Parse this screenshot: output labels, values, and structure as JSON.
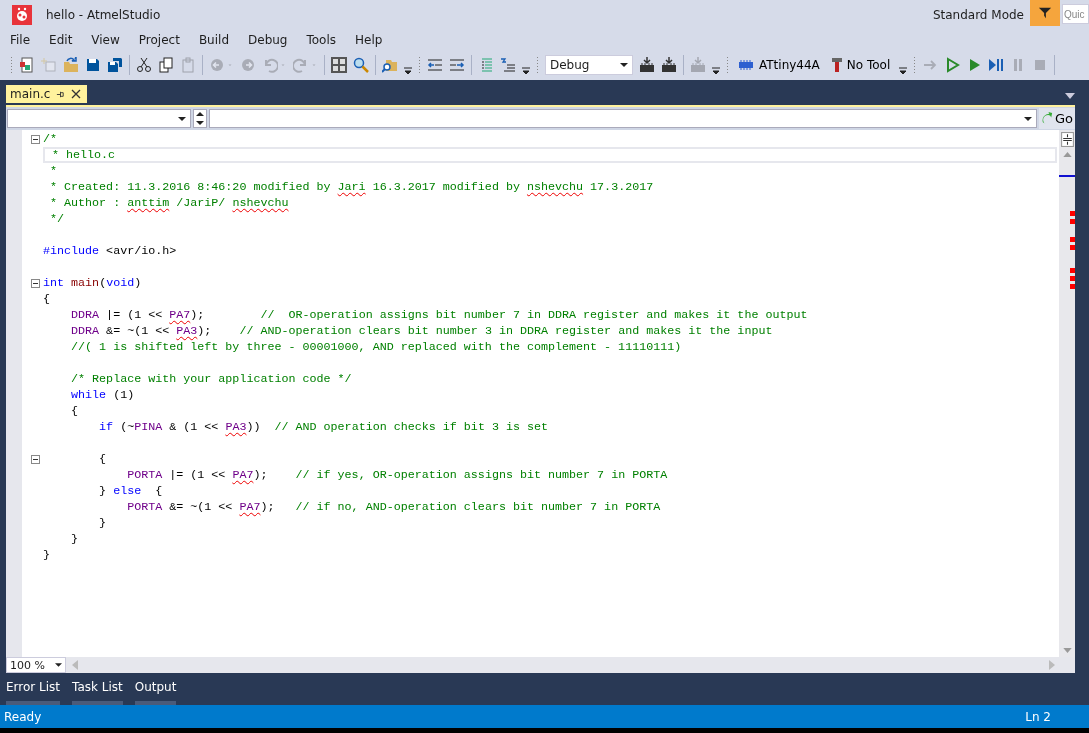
{
  "window": {
    "title": "hello - AtmelStudio"
  },
  "mode": {
    "label": "Standard Mode"
  },
  "quick_launch": {
    "placeholder": "Quic"
  },
  "menu": [
    "File",
    "Edit",
    "View",
    "Project",
    "Build",
    "Debug",
    "Tools",
    "Help"
  ],
  "toolbar": [
    {
      "kind": "grip"
    },
    {
      "kind": "new-project",
      "disabled": false
    },
    {
      "kind": "add-item",
      "disabled": true
    },
    {
      "kind": "open",
      "disabled": false
    },
    {
      "kind": "save",
      "disabled": false
    },
    {
      "kind": "save-all",
      "disabled": false
    },
    {
      "kind": "sep"
    },
    {
      "kind": "cut",
      "disabled": false
    },
    {
      "kind": "copy",
      "disabled": false
    },
    {
      "kind": "paste",
      "disabled": true
    },
    {
      "kind": "sep"
    },
    {
      "kind": "back",
      "disabled": true
    },
    {
      "kind": "caret",
      "disabled": true
    },
    {
      "kind": "forward",
      "disabled": true
    },
    {
      "kind": "undo",
      "disabled": true
    },
    {
      "kind": "caret",
      "disabled": true
    },
    {
      "kind": "redo",
      "disabled": true
    },
    {
      "kind": "caret",
      "disabled": true
    },
    {
      "kind": "sep"
    },
    {
      "kind": "grid",
      "disabled": false
    },
    {
      "kind": "find",
      "disabled": false
    },
    {
      "kind": "sep"
    },
    {
      "kind": "find-files",
      "disabled": false
    },
    {
      "kind": "overflow"
    },
    {
      "kind": "grip"
    },
    {
      "kind": "outdent",
      "disabled": false
    },
    {
      "kind": "indent",
      "disabled": false
    },
    {
      "kind": "sep"
    },
    {
      "kind": "comment",
      "disabled": false
    },
    {
      "kind": "uncomment",
      "disabled": false
    },
    {
      "kind": "overflow"
    },
    {
      "kind": "grip"
    },
    {
      "kind": "combo",
      "value": "Debug"
    },
    {
      "kind": "program",
      "disabled": false
    },
    {
      "kind": "program",
      "disabled": false
    },
    {
      "kind": "sep"
    },
    {
      "kind": "program",
      "disabled": true
    },
    {
      "kind": "overflow"
    },
    {
      "kind": "grip"
    },
    {
      "kind": "device",
      "label": "ATtiny44A"
    },
    {
      "kind": "tool",
      "label": "No Tool"
    },
    {
      "kind": "overflow"
    },
    {
      "kind": "grip"
    },
    {
      "kind": "arrow",
      "disabled": true
    },
    {
      "kind": "play-outline",
      "disabled": false
    },
    {
      "kind": "play",
      "disabled": false
    },
    {
      "kind": "step",
      "disabled": false
    },
    {
      "kind": "pause",
      "disabled": true
    },
    {
      "kind": "stop",
      "disabled": true
    },
    {
      "kind": "sep"
    }
  ],
  "tabs": [
    {
      "label": "main.c",
      "selected": true
    }
  ],
  "go_button": {
    "label": "Go"
  },
  "code": [
    {
      "fold": true,
      "current": false,
      "tokens": [
        {
          "t": "/*",
          "kind": "comment"
        }
      ]
    },
    {
      "fold": false,
      "current": true,
      "tokens": [
        {
          "t": " * hello.c",
          "kind": "comment"
        }
      ]
    },
    {
      "fold": false,
      "current": false,
      "tokens": [
        {
          "t": " *",
          "kind": "comment"
        }
      ]
    },
    {
      "fold": false,
      "current": false,
      "tokens": [
        {
          "t": " * Created: 11.3.2016 8:46:20 modified by ",
          "kind": "comment"
        },
        {
          "t": "Jari",
          "kind": "comment-typo"
        },
        {
          "t": " 16.3.2017 modified by ",
          "kind": "comment"
        },
        {
          "t": "nshevchu",
          "kind": "comment-typo"
        },
        {
          "t": " 17.3.2017",
          "kind": "comment"
        }
      ]
    },
    {
      "fold": false,
      "current": false,
      "tokens": [
        {
          "t": " * Author : ",
          "kind": "comment"
        },
        {
          "t": "anttim",
          "kind": "comment-typo"
        },
        {
          "t": " /JariP/ ",
          "kind": "comment"
        },
        {
          "t": "nshevchu",
          "kind": "comment-typo"
        }
      ]
    },
    {
      "fold": false,
      "current": false,
      "tokens": [
        {
          "t": " */",
          "kind": "comment"
        }
      ]
    },
    {
      "fold": false,
      "current": false
    },
    {
      "fold": false,
      "current": false,
      "tokens": [
        {
          "t": "#include",
          "kind": "keyword"
        },
        {
          "t": " <avr/io.h>",
          "kind": "plain"
        }
      ]
    },
    {
      "fold": false,
      "current": false
    },
    {
      "fold": true,
      "current": false,
      "tokens": [
        {
          "t": "int ",
          "kind": "keyword"
        },
        {
          "t": "main",
          "kind": "function"
        },
        {
          "t": "(",
          "kind": "plain"
        },
        {
          "t": "void",
          "kind": "keyword"
        },
        {
          "t": ")",
          "kind": "plain"
        }
      ]
    },
    {
      "fold": false,
      "current": false,
      "tokens": [
        {
          "t": "{",
          "kind": "plain"
        }
      ]
    },
    {
      "fold": false,
      "current": false,
      "tokens": [
        {
          "t": "    DDRA",
          "kind": "macro"
        },
        {
          "t": " |= (1 << ",
          "kind": "plain"
        },
        {
          "t": "PA7",
          "kind": "macro-typo"
        },
        {
          "t": ");        ",
          "kind": "plain"
        },
        {
          "t": "//  OR-operation assigns bit number 7 in DDRA register and makes it the output",
          "kind": "comment"
        }
      ]
    },
    {
      "fold": false,
      "current": false,
      "tokens": [
        {
          "t": "    DDRA",
          "kind": "macro"
        },
        {
          "t": " &= ~(1 << ",
          "kind": "plain"
        },
        {
          "t": "PA3",
          "kind": "macro-typo"
        },
        {
          "t": ");    ",
          "kind": "plain"
        },
        {
          "t": "// AND-operation clears bit number 3 in DDRA register and makes it the input",
          "kind": "comment"
        }
      ]
    },
    {
      "fold": false,
      "current": false,
      "tokens": [
        {
          "t": "    //( 1 is shifted left by three - 00001000, AND replaced with the complement - 11110111)",
          "kind": "comment"
        }
      ]
    },
    {
      "fold": false,
      "current": false
    },
    {
      "fold": false,
      "current": false,
      "tokens": [
        {
          "t": "    /* Replace with your application code */",
          "kind": "comment"
        }
      ]
    },
    {
      "fold": false,
      "current": false,
      "tokens": [
        {
          "t": "    while",
          "kind": "keyword"
        },
        {
          "t": " (1)",
          "kind": "plain"
        }
      ]
    },
    {
      "fold": false,
      "current": false,
      "tokens": [
        {
          "t": "    {",
          "kind": "plain"
        }
      ]
    },
    {
      "fold": false,
      "current": false,
      "tokens": [
        {
          "t": "        if",
          "kind": "keyword"
        },
        {
          "t": " (~",
          "kind": "plain"
        },
        {
          "t": "PINA",
          "kind": "macro"
        },
        {
          "t": " & (1 << ",
          "kind": "plain"
        },
        {
          "t": "PA3",
          "kind": "macro-typo"
        },
        {
          "t": "))  ",
          "kind": "plain"
        },
        {
          "t": "// AND operation checks if bit 3 is set",
          "kind": "comment"
        }
      ]
    },
    {
      "fold": false,
      "current": false
    },
    {
      "fold": true,
      "current": false,
      "tokens": [
        {
          "t": "        {",
          "kind": "plain"
        }
      ]
    },
    {
      "fold": false,
      "current": false,
      "tokens": [
        {
          "t": "            PORTA",
          "kind": "macro"
        },
        {
          "t": " |= (1 << ",
          "kind": "plain"
        },
        {
          "t": "PA7",
          "kind": "macro-typo"
        },
        {
          "t": ");    ",
          "kind": "plain"
        },
        {
          "t": "// if yes, OR-operation assigns bit number 7 in PORTA",
          "kind": "comment"
        }
      ]
    },
    {
      "fold": false,
      "current": false,
      "tokens": [
        {
          "t": "        } ",
          "kind": "plain"
        },
        {
          "t": "else",
          "kind": "keyword"
        },
        {
          "t": "  {",
          "kind": "plain"
        }
      ]
    },
    {
      "fold": false,
      "current": false,
      "tokens": [
        {
          "t": "            PORTA",
          "kind": "macro"
        },
        {
          "t": " &= ~(1 << ",
          "kind": "plain"
        },
        {
          "t": "PA7",
          "kind": "macro-typo"
        },
        {
          "t": ");   ",
          "kind": "plain"
        },
        {
          "t": "// if no, AND-operation clears bit number 7 in PORTA",
          "kind": "comment"
        }
      ]
    },
    {
      "fold": false,
      "current": false,
      "tokens": [
        {
          "t": "        }",
          "kind": "plain"
        }
      ]
    },
    {
      "fold": false,
      "current": false,
      "tokens": [
        {
          "t": "    }",
          "kind": "plain"
        }
      ]
    },
    {
      "fold": false,
      "current": false,
      "tokens": [
        {
          "t": "}",
          "kind": "plain"
        }
      ]
    }
  ],
  "zoom": {
    "value": "100 %"
  },
  "bottom_tabs": [
    "Error List",
    "Task List",
    "Output"
  ],
  "status_bar": {
    "left": "Ready",
    "right": "Ln 2"
  }
}
